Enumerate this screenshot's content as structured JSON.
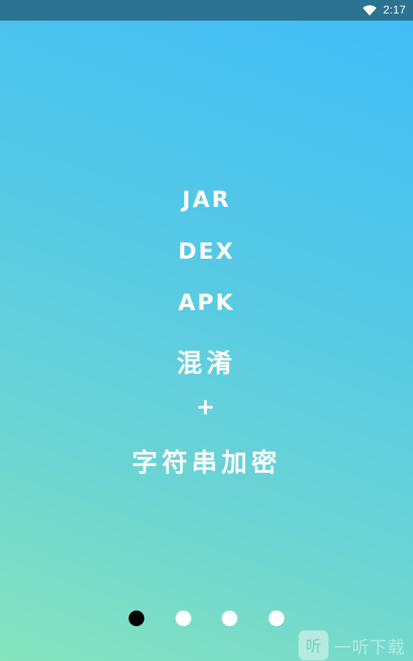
{
  "status_bar": {
    "time": "2:17",
    "wifi_icon": "wifi-icon"
  },
  "intro": {
    "lines": [
      "JAR",
      "DEX",
      "APK",
      "混淆",
      "+",
      "字符串加密"
    ]
  },
  "pager": {
    "count": 4,
    "active_index": 0
  },
  "watermark": {
    "logo_char": "听",
    "text": "一听下载"
  },
  "colors": {
    "status_bar": "#2b7390",
    "gradient_top": "#3fbcf7",
    "gradient_bottom": "#85e3bd",
    "text": "#ffffff",
    "dot_active": "#000000",
    "dot_inactive": "#ffffff"
  }
}
